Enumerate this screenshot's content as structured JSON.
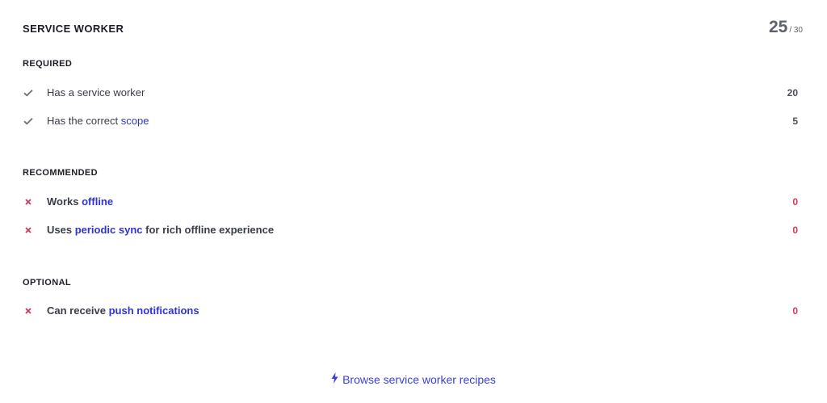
{
  "card": {
    "title": "SERVICE WORKER",
    "score": "25",
    "score_max": "/ 30"
  },
  "sections": {
    "required": {
      "title": "REQUIRED",
      "items": [
        {
          "status": "pass",
          "text": "Has a service worker",
          "link": "",
          "suffix": "",
          "points": "20"
        },
        {
          "status": "pass",
          "text": "Has the correct ",
          "link": "scope",
          "suffix": "",
          "points": "5"
        }
      ]
    },
    "recommended": {
      "title": "RECOMMENDED",
      "items": [
        {
          "status": "fail",
          "text": "Works ",
          "link": "offline",
          "suffix": "",
          "points": "0"
        },
        {
          "status": "fail",
          "text": "Uses ",
          "link": "periodic sync",
          "suffix": " for rich offline experience",
          "points": "0"
        }
      ]
    },
    "optional": {
      "title": "OPTIONAL",
      "items": [
        {
          "status": "fail",
          "text": "Can receive ",
          "link": "push notifications",
          "suffix": "",
          "points": "0"
        }
      ]
    }
  },
  "footer": {
    "link_label": "Browse service worker recipes",
    "icon": "lightning-bolt-icon"
  },
  "colors": {
    "link": "#2d33d6",
    "fail": "#d4365a",
    "pass_icon": "#626670"
  }
}
